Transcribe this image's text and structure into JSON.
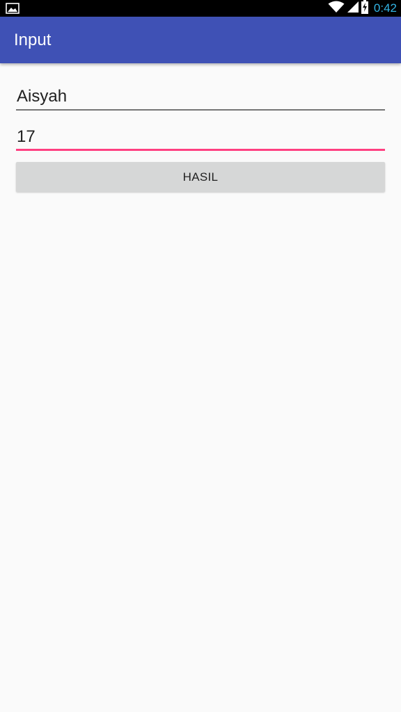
{
  "status_bar": {
    "time": "0:42",
    "left_icon": "image-icon",
    "icons": [
      "wifi-icon",
      "signal-icon",
      "battery-charging-icon"
    ]
  },
  "app_bar": {
    "title": "Input",
    "color": "#3f51b5"
  },
  "form": {
    "name_value": "Aisyah",
    "age_value": "17",
    "button_label": "HASIL"
  },
  "colors": {
    "accent": "#ff4081",
    "time": "#33b5e5"
  }
}
